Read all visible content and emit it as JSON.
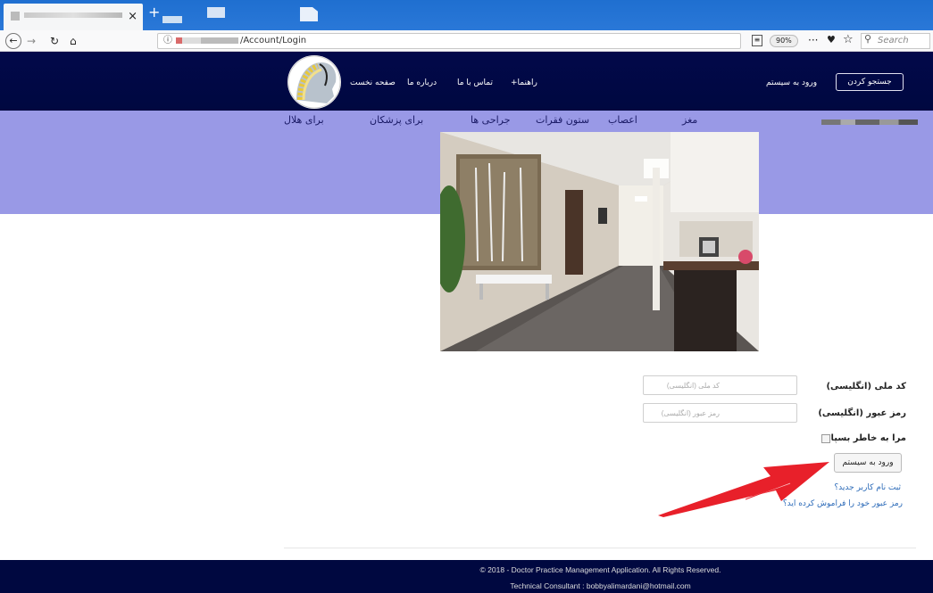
{
  "browser": {
    "tab_close": "×",
    "new_tab": "+",
    "url_path": "/Account/Login",
    "url_info_icon": "ⓘ",
    "zoom": "90%",
    "more": "···",
    "search_placeholder": "Search",
    "icons": [
      "back-icon",
      "forward-icon",
      "reload-icon",
      "home-icon",
      "reader-view-icon",
      "pocket-icon",
      "bookmark-star-icon",
      "search-icon"
    ]
  },
  "header": {
    "nav_home": "صفحه نخست",
    "nav_about": "درباره ما",
    "nav_contact": "تماس با ما",
    "nav_guide": "راهنما+",
    "login_link": "ورود به سیستم",
    "search_button": "جستجو کردن"
  },
  "categories": {
    "brain": "مغز",
    "nerves": "اعصاب",
    "spine": "ستون فقرات",
    "surgeries": "جراحی ها",
    "doctors": "برای پزشکان",
    "hilal": "برای هلال"
  },
  "form": {
    "national_id_label": "کد ملی (انگلیسی)",
    "national_id_placeholder": "کد ملی (انگلیسی)",
    "password_label": "رمز عبور (انگلیسی)",
    "password_placeholder": "رمز عبور (انگلیسی)",
    "remember_label": "مرا به خاطر بسپار",
    "login_button": "ورود به سیستم",
    "register_link": "ثبت نام کاربر جدید؟",
    "forgot_link": "رمز عبور خود را فراموش کرده اید؟"
  },
  "footer": {
    "copyright": "© 2018 - Doctor Practice Management Application. All Rights Reserved.",
    "consultant": "Technical Consultant : bobbyalimardani@hotmail.com"
  },
  "colors": {
    "header_bg": "#000a4a",
    "category_band": "#9999e6",
    "footer_bg": "#000840",
    "annotation_arrow": "#e8202a",
    "link": "#2b6ab8"
  }
}
